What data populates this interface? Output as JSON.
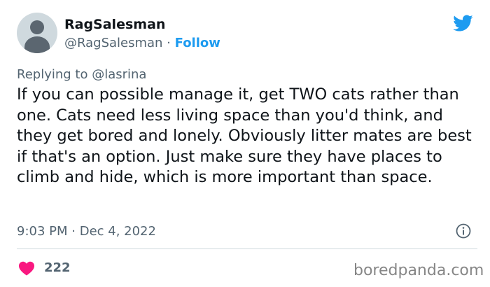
{
  "user": {
    "display_name": "RagSalesman",
    "handle": "@RagSalesman",
    "separator": " · ",
    "follow_label": "Follow"
  },
  "reply": {
    "prefix": "Replying to ",
    "mention": "@lasrina"
  },
  "tweet": {
    "text": "If you can possible manage it, get TWO cats rather than one. Cats need less living space than you'd think, and they get bored and lonely. Obviously litter mates are best if that's an option. Just make sure they have places to climb and hide, which is more important than space.",
    "time": "9:03 PM",
    "date_separator": " · ",
    "date": "Dec 4, 2022"
  },
  "likes": {
    "count": "222"
  },
  "watermark": {
    "text": "boredpanda.com"
  },
  "colors": {
    "accent": "#1d9bf0",
    "heart": "#f91880",
    "secondary_text": "#536471"
  },
  "icons": {
    "logo": "twitter-bird-icon",
    "info": "info-icon",
    "like": "heart-icon"
  }
}
